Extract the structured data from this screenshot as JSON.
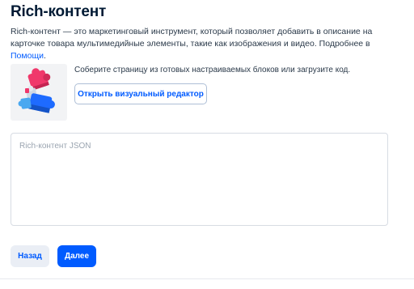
{
  "page": {
    "title": "Rich-контент",
    "description_text": "Rich-контент — это маркетинговый инструмент, который позволяет добавить в описание на карточке товара мультимедийные элементы, такие как изображения и видео. Подробнее в ",
    "help_link": "Помощи",
    "description_end": "."
  },
  "editor": {
    "illustration_icon": "puzzle-pieces-icon",
    "text": "Соберите страницу из готовых настраиваемых блоков или загрузите код.",
    "open_button": "Открыть визуальный редактор"
  },
  "json_input": {
    "placeholder": "Rich-контент JSON",
    "value": ""
  },
  "actions": {
    "back": "Назад",
    "next": "Далее"
  },
  "colors": {
    "accent": "#005bff",
    "puzzle_pink": "#f0386b",
    "puzzle_blue": "#1e6bff",
    "puzzle_lightblue": "#4aa8f0"
  }
}
